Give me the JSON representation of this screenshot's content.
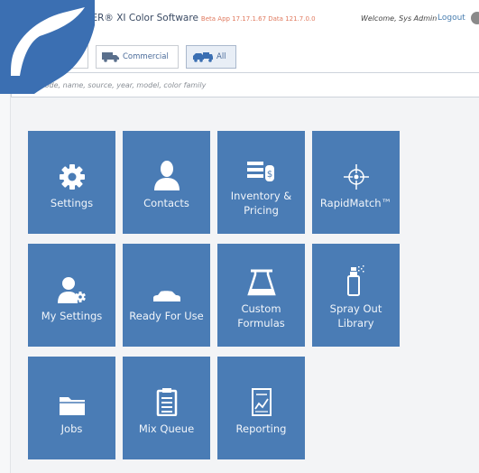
{
  "header": {
    "app_title": "sER® XI Color Software",
    "build_info": "Beta App 17.17.1.67 Data 121.7.0.0",
    "welcome": "Welcome, Sys Admin",
    "logout": "Logout"
  },
  "filters": {
    "commercial": "Commercial",
    "all": "All"
  },
  "search": {
    "placeholder": "color code, name, source, year, model, color family"
  },
  "tiles": [
    {
      "label": "Settings",
      "icon": "gear-icon"
    },
    {
      "label": "Contacts",
      "icon": "person-icon"
    },
    {
      "label": "Inventory & Pricing",
      "icon": "inventory-icon"
    },
    {
      "label": "RapidMatch™",
      "icon": "crosshair-icon"
    },
    {
      "label": "My Settings",
      "icon": "user-gear-icon"
    },
    {
      "label": "Ready For Use",
      "icon": "car-icon"
    },
    {
      "label": "Custom Formulas",
      "icon": "beaker-icon"
    },
    {
      "label": "Spray Out Library",
      "icon": "spray-can-icon"
    },
    {
      "label": "Jobs",
      "icon": "folder-icon"
    },
    {
      "label": "Mix Queue",
      "icon": "clipboard-icon"
    },
    {
      "label": "Reporting",
      "icon": "report-icon"
    }
  ],
  "colors": {
    "tile": "#4a7cb5",
    "logo": "#3b6fb2",
    "link": "#4a7fb0"
  }
}
